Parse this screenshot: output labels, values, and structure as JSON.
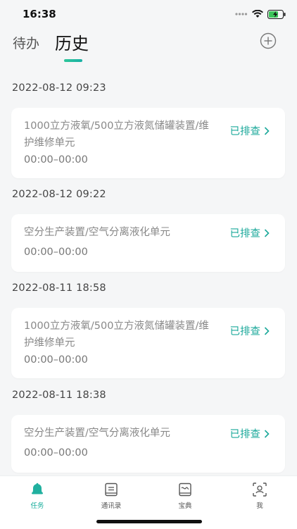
{
  "status_bar": {
    "time": "16:38"
  },
  "header": {
    "tabs": [
      {
        "label": "待办",
        "active": false
      },
      {
        "label": "历史",
        "active": true
      }
    ],
    "add_icon": "plus-circle-icon"
  },
  "history": [
    {
      "date": "2022-08-12 09:23",
      "title": "1000立方液氧/500立方液氮储罐装置/维护维修单元",
      "time_range": "00:00–00:00",
      "status": "已排查"
    },
    {
      "date": "2022-08-12 09:22",
      "title": "空分生产装置/空气分离液化单元",
      "time_range": "00:00–00:00",
      "status": "已排查"
    },
    {
      "date": "2022-08-11 18:58",
      "title": "1000立方液氧/500立方液氮储罐装置/维护维修单元",
      "time_range": "00:00–00:00",
      "status": "已排查"
    },
    {
      "date": "2022-08-11 18:38",
      "title": "空分生产装置/空气分离液化单元",
      "time_range": "00:00–00:00",
      "status": "已排查"
    }
  ],
  "bottom_nav": [
    {
      "label": "任务",
      "icon": "bell-icon",
      "active": true
    },
    {
      "label": "通讯录",
      "icon": "contacts-book-icon",
      "active": false
    },
    {
      "label": "宝典",
      "icon": "handbook-icon",
      "active": false
    },
    {
      "label": "我",
      "icon": "profile-scan-icon",
      "active": false
    }
  ],
  "colors": {
    "accent": "#1aa89a",
    "background": "#f5f6f7"
  }
}
